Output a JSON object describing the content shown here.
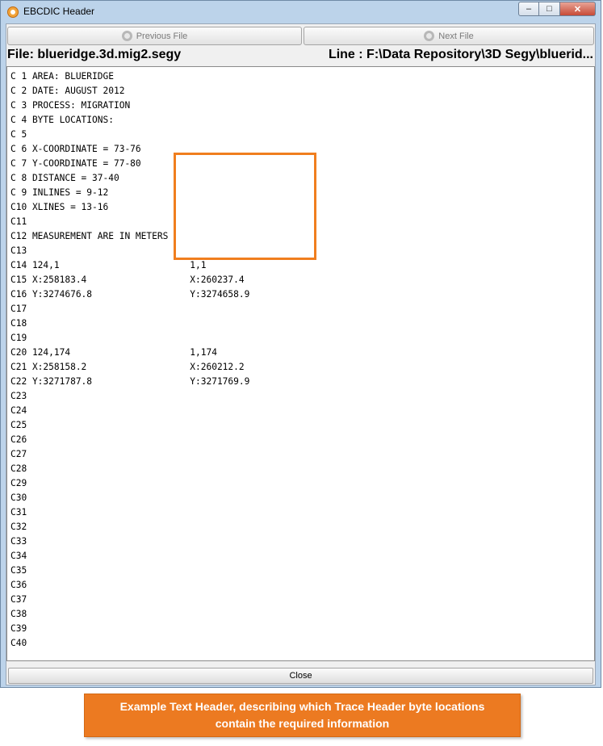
{
  "window": {
    "title": "EBCDIC Header"
  },
  "toolbar": {
    "previous_label": "Previous File",
    "next_label": "Next File"
  },
  "info": {
    "file": "File: blueridge.3d.mig2.segy",
    "line": "Line : F:\\Data Repository\\3D Segy\\bluerid..."
  },
  "header_lines": [
    "C 1 AREA: BLUERIDGE",
    "C 2 DATE: AUGUST 2012",
    "C 3 PROCESS: MIGRATION",
    "C 4 BYTE LOCATIONS:",
    "C 5",
    "C 6 X-COORDINATE = 73-76",
    "C 7 Y-COORDINATE = 77-80",
    "C 8 DISTANCE = 37-40",
    "C 9 INLINES = 9-12",
    "C10 XLINES = 13-16",
    "C11",
    "C12 MEASUREMENT ARE IN METERS",
    "C13",
    "C14 124,1                        1,1",
    "C15 X:258183.4                   X:260237.4",
    "C16 Y:3274676.8                  Y:3274658.9",
    "C17",
    "C18",
    "C19",
    "C20 124,174                      1,174",
    "C21 X:258158.2                   X:260212.2",
    "C22 Y:3271787.8                  Y:3271769.9",
    "C23",
    "C24",
    "C25",
    "C26",
    "C27",
    "C28",
    "C29",
    "C30",
    "C31",
    "C32",
    "C33",
    "C34",
    "C35",
    "C36",
    "C37",
    "C38",
    "C39",
    "C40"
  ],
  "footer": {
    "close_label": "Close"
  },
  "caption": {
    "line1": "Example Text Header, describing which Trace Header byte locations",
    "line2": "contain the required information"
  },
  "colors": {
    "accent": "#ec7a21",
    "highlight_border": "#f07e1e"
  },
  "icons": {
    "app": "app-icon",
    "prev": "previous-file-icon",
    "next": "next-file-icon"
  }
}
